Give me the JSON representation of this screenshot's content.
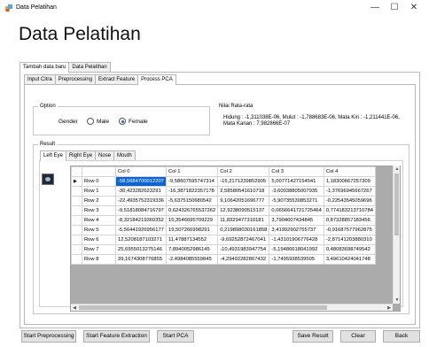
{
  "window": {
    "title": "Data Pelatihan",
    "minimize": "—",
    "maximize": "☐",
    "close": "✕"
  },
  "heading": "Data Pelatihan",
  "top_tabs": [
    "Tambah data baru",
    "Data Pelatihan"
  ],
  "process_tabs": [
    "Input Citra",
    "Preprocessing",
    "Extract Feature",
    "Process PCA"
  ],
  "option": {
    "label": "Option",
    "gender_label": "Gender",
    "male": "Male",
    "female": "Female",
    "selected": "Female"
  },
  "mean": {
    "label": "Nilai Rata-rata",
    "text": "Hidung : -1,311038E-06, Mulut : -1,788683E-06, Mata Kiri : -1,211441E-06, Mata Kanan : 7,982866E-07"
  },
  "result": {
    "label": "Result",
    "tabs": [
      "Left Eye",
      "Right Eye",
      "Nose",
      "Mouth"
    ],
    "active_tab": "Left Eye"
  },
  "grid": {
    "columns": [
      "Col 0",
      "Col 1",
      "Col 2",
      "Col 3",
      "Col 4"
    ],
    "rows": [
      {
        "name": "Row 0",
        "cells": [
          "-58,5684700012207",
          "-9,58607595747314",
          "-15,2171239852905",
          "5,00771427154541",
          "1,18300667257309"
        ]
      },
      {
        "name": "Row 1",
        "cells": [
          "-30,423282623291",
          "-16,3871822357178",
          "2,58580541610718",
          "-3,60038805007935",
          "-1,37696945667267"
        ]
      },
      {
        "name": "Row 2",
        "cells": [
          "-22,4935752319336",
          "-5,6375150680542",
          "9,10642051696777",
          "-5,90735530853271",
          "-0,22543545059696"
        ]
      },
      {
        "name": "Row 3",
        "cells": [
          "-9,51818084716797",
          "0,624326765537262",
          "12,9238090515137",
          "0,0656641721725464",
          "0,774183213710784"
        ]
      },
      {
        "name": "Row 4",
        "cells": [
          "-8,32184219360352",
          "15,3546695709229",
          "11,8329477310181",
          "3,7904007434845",
          "0,87328857183456"
        ]
      },
      {
        "name": "Row 5",
        "cells": [
          "-5,56441926956177",
          "19,507266998291",
          "0,219898030161858",
          "3,41992902755737",
          "-0,91687577962875"
        ]
      },
      {
        "name": "Row 6",
        "cells": [
          "12,5208187103271",
          "11,47887134552",
          "-9,69252872467041",
          "-1,43101906776428",
          "-2,87141203880310"
        ]
      },
      {
        "name": "Row 7",
        "cells": [
          "25,6955013275146",
          "7,8940052986145",
          "-10,4931983947754",
          "-5,19486618041992",
          "0,48083698749542"
        ]
      },
      {
        "name": "Row 8",
        "cells": [
          "39,1674308776855",
          "-2,4984085559845",
          "-4,29492282867432",
          "-1,7495938539505",
          "3,49610424041748"
        ]
      }
    ],
    "selected_cell": "0,0"
  },
  "buttons": {
    "start_preprocessing": "Start Preprocessing",
    "start_feature": "Start Feature Extraction",
    "start_pca": "Start PCA",
    "save_result": "Save Result",
    "clear": "Clear",
    "back": "Back"
  }
}
